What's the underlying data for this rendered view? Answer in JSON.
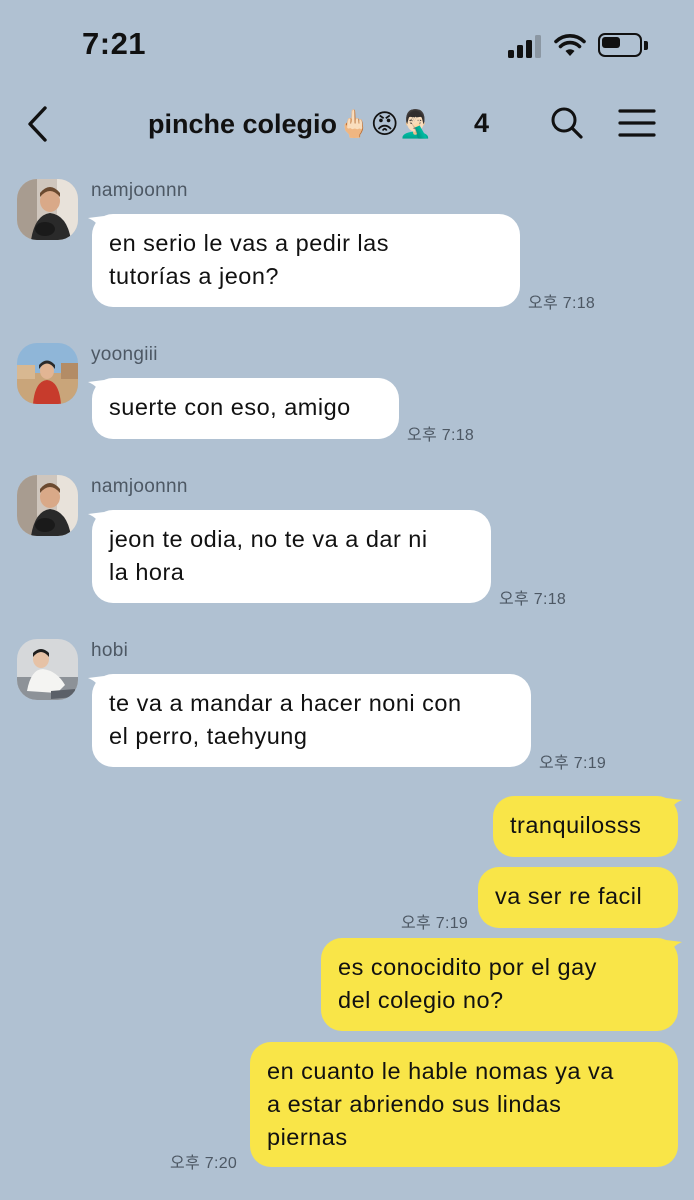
{
  "status_bar": {
    "time": "7:21",
    "signal_icon": "cellular-signal-icon",
    "wifi_icon": "wifi-icon",
    "battery_icon": "battery-icon",
    "battery_level": 0.5
  },
  "header": {
    "back_icon": "chevron-left-icon",
    "title": "pinche colegio🖕🏻😡🤦🏻‍♂️",
    "member_count": "4",
    "search_icon": "search-icon",
    "menu_icon": "hamburger-menu-icon"
  },
  "colors": {
    "background": "#b0c1d2",
    "incoming_bubble": "#ffffff",
    "outgoing_bubble": "#f9e548",
    "meta_text": "#4d5864"
  },
  "messages": [
    {
      "direction": "in",
      "sender": "namjoonnn",
      "lines": [
        "en serio le vas a pedir las",
        "tutorías a jeon?"
      ],
      "time": "오후 7:18"
    },
    {
      "direction": "in",
      "sender": "yoongiii",
      "lines": [
        "suerte con eso, amigo"
      ],
      "time": "오후 7:18"
    },
    {
      "direction": "in",
      "sender": "namjoonnn",
      "lines": [
        "jeon te odia, no te va a dar ni",
        "la hora"
      ],
      "time": "오후 7:18"
    },
    {
      "direction": "in",
      "sender": "hobi",
      "lines": [
        "te va a mandar a hacer noni con",
        "el perro, taehyung"
      ],
      "time": "오후 7:19"
    },
    {
      "direction": "out",
      "lines": [
        "tranquilosss"
      ],
      "time": ""
    },
    {
      "direction": "out",
      "lines": [
        "va ser re facil"
      ],
      "time": "오후 7:19"
    },
    {
      "direction": "out",
      "lines": [
        "es conocidito por el gay",
        "del colegio no?"
      ],
      "time": ""
    },
    {
      "direction": "out",
      "lines": [
        "en cuanto le hable nomas ya va",
        "a estar abriendo sus lindas",
        "piernas"
      ],
      "time": "오후 7:20"
    }
  ]
}
